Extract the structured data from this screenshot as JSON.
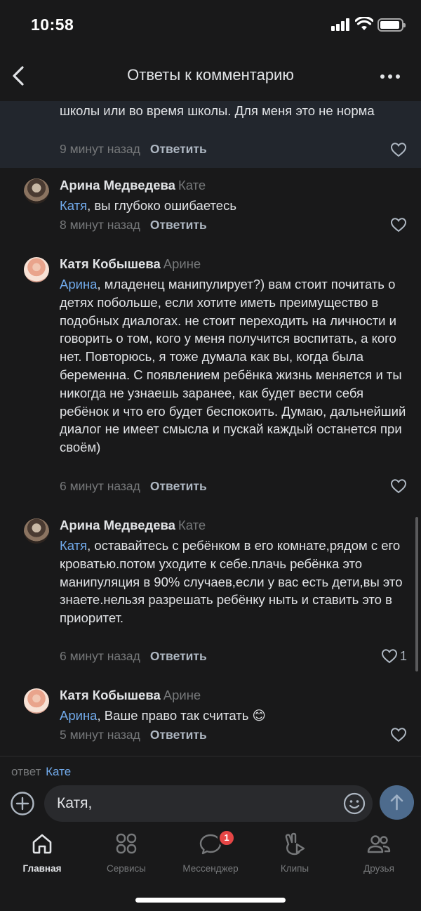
{
  "status_bar": {
    "time": "10:58"
  },
  "header": {
    "title": "Ответы к комментарию"
  },
  "comments": [
    {
      "text": "школы или во время школы. Для меня это не норма",
      "time": "9 минут назад",
      "reply_label": "Ответить",
      "likes": ""
    },
    {
      "author": "Арина Медведева",
      "reply_to": "Кате",
      "mention": "Катя",
      "text": ", вы глубоко ошибаетесь",
      "time": "8 минут назад",
      "reply_label": "Ответить",
      "likes": ""
    },
    {
      "author": "Катя Кобышева",
      "reply_to": "Арине",
      "mention": "Арина",
      "text": ", младенец манипулирует?)  вам стоит почитать о детях побольше, если хотите иметь преимущество в подобных диалогах. не стоит переходить на личности и говорить о том, кого у меня получится воспитать, а кого нет. Повторюсь, я тоже думала как вы, когда была беременна. С появлением ребёнка жизнь меняется и ты никогда не узнаешь заранее, как будет вести себя ребёнок и что его будет беспокоить. Думаю, дальнейший диалог не имеет смысла и пускай каждый останется при своём)",
      "time": "6 минут назад",
      "reply_label": "Ответить",
      "likes": ""
    },
    {
      "author": "Арина Медведева",
      "reply_to": "Кате",
      "mention": "Катя",
      "text": ", оставайтесь с ребёнком в его комнате,рядом с его кроватью.потом уходите к себе.плачь ребёнка это манипуляция в 90% случаев,если у вас есть дети,вы это знаете.нельзя разрешать ребёнку ныть и ставить это в приоритет.",
      "time": "6 минут назад",
      "reply_label": "Ответить",
      "likes": "1"
    },
    {
      "author": "Катя Кобышева",
      "reply_to": "Арине",
      "mention": "Арина",
      "text": ", Ваше право так считать 😊",
      "time": "5 минут назад",
      "reply_label": "Ответить",
      "likes": ""
    }
  ],
  "composer": {
    "reply_prefix": "ответ",
    "reply_target": "Кате",
    "value": "Катя,"
  },
  "tabs": [
    {
      "label": "Главная",
      "icon": "home-icon",
      "active": true
    },
    {
      "label": "Сервисы",
      "icon": "services-icon",
      "active": false
    },
    {
      "label": "Мессенджер",
      "icon": "messenger-icon",
      "active": false,
      "badge": "1"
    },
    {
      "label": "Клипы",
      "icon": "clips-icon",
      "active": false
    },
    {
      "label": "Друзья",
      "icon": "friends-icon",
      "active": false
    }
  ],
  "colors": {
    "background": "#19191a",
    "highlight": "#22262d",
    "text": "#e1e3e6",
    "secondary": "#76787a",
    "mention": "#71aaeb",
    "badge": "#e64646",
    "send_button": "#4d6b8d"
  }
}
